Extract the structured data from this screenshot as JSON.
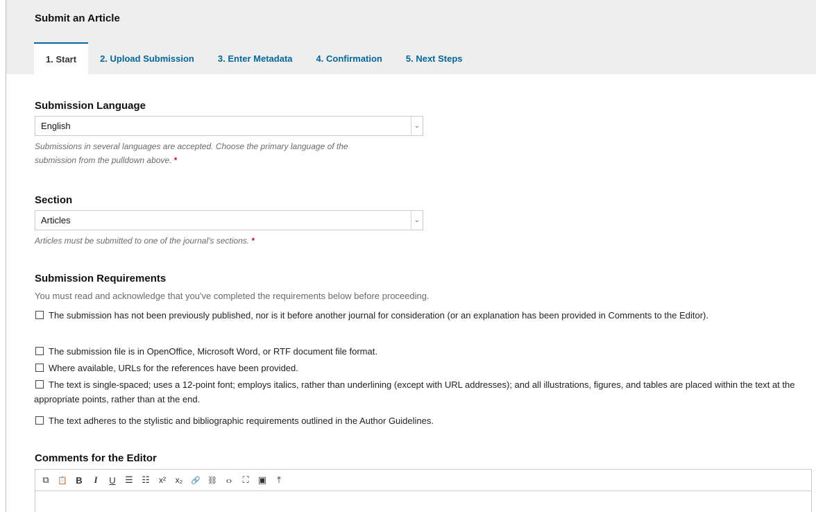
{
  "page": {
    "title": "Submit an Article"
  },
  "tabs": [
    {
      "label": "1. Start"
    },
    {
      "label": "2. Upload Submission"
    },
    {
      "label": "3. Enter Metadata"
    },
    {
      "label": "4. Confirmation"
    },
    {
      "label": "5. Next Steps"
    }
  ],
  "language": {
    "label": "Submission Language",
    "value": "English",
    "help_line1": "Submissions in several languages are accepted. Choose the primary language of the",
    "help_line2": "submission from the pulldown above.",
    "required_mark": "*"
  },
  "section": {
    "label": "Section",
    "value": "Articles",
    "help": "Articles must be submitted to one of the journal's sections.",
    "required_mark": "*"
  },
  "requirements": {
    "label": "Submission Requirements",
    "intro": "You must read and acknowledge that you've completed the requirements below before proceeding.",
    "items": [
      {
        "text": "The submission has not been previously published, nor is it before another journal for consideration (or an explanation has been provided in Comments to the Editor)."
      },
      {
        "text": "The submission file is in OpenOffice, Microsoft Word, or RTF document file format."
      },
      {
        "text": "Where available, URLs for the references have been provided."
      },
      {
        "text": "The text is single-spaced; uses a 12-point font; employs italics, rather than underlining (except with URL addresses); and all illustrations, figures, and tables are placed within the text at the appropriate points, rather than at the end."
      },
      {
        "text": "The text adheres to the stylistic and bibliographic requirements outlined in the Author Guidelines."
      }
    ]
  },
  "comments": {
    "label": "Comments for the Editor",
    "toolbar": [
      {
        "icon": "copy-icon",
        "glyph": "⧉"
      },
      {
        "icon": "paste-icon",
        "glyph": "📋"
      },
      {
        "icon": "bold-icon",
        "glyph": "B"
      },
      {
        "icon": "italic-icon",
        "glyph": "I"
      },
      {
        "icon": "underline-icon",
        "glyph": "U"
      },
      {
        "icon": "bullet-list-icon",
        "glyph": "☰"
      },
      {
        "icon": "numbered-list-icon",
        "glyph": "☷"
      },
      {
        "icon": "superscript-icon",
        "glyph": "x²"
      },
      {
        "icon": "subscript-icon",
        "glyph": "x₂"
      },
      {
        "icon": "link-icon",
        "glyph": "🔗"
      },
      {
        "icon": "unlink-icon",
        "glyph": "⛓"
      },
      {
        "icon": "code-icon",
        "glyph": "‹›"
      },
      {
        "icon": "fullscreen-icon",
        "glyph": "⛶"
      },
      {
        "icon": "image-icon",
        "glyph": "▣"
      },
      {
        "icon": "upload-icon",
        "glyph": "⤒"
      }
    ]
  },
  "colors": {
    "accent": "#006798",
    "required": "#c2123a",
    "header_bg": "#eeeeee"
  }
}
